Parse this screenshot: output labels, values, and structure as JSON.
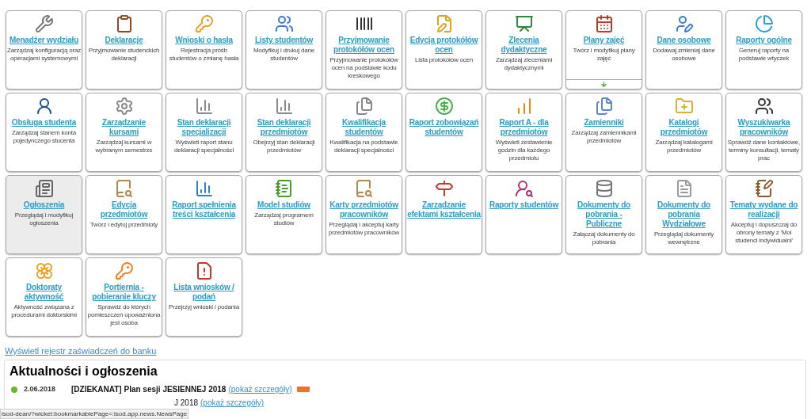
{
  "tiles": [
    {
      "title": "Menadżer wydziału",
      "description": "Zarządzaj konfiguracją oraz operacjami systemowymi",
      "selected": false,
      "kind": "plain"
    },
    {
      "title": "Deklaracje",
      "description": "Przyjmowanie studenckich deklaracji",
      "selected": false,
      "kind": "plain"
    },
    {
      "title": "Wnioski o hasła",
      "description": "Rejestracja próśb studentów o zmianę hasła",
      "selected": false,
      "kind": "plain"
    },
    {
      "title": "Listy studentów",
      "description": "Modyfikuj i drukuj dane studentów",
      "selected": false,
      "kind": "plain"
    },
    {
      "title": "Przyjmowanie protokółów ocen",
      "description": "Przyjmowanie protokółów ocen na podstawie kodu kreskowego",
      "selected": false,
      "kind": "plain"
    },
    {
      "title": "Edycja protokółów ocen",
      "description": "Lista protokółów ocen",
      "selected": false,
      "kind": "plain"
    },
    {
      "title": "Zlecenia dydaktyczne",
      "description": "Zarządzaj zleceniami dydaktycznymi",
      "selected": false,
      "kind": "plain"
    },
    {
      "title": "Plany zajęć",
      "description": "Twórz i modyfikuj plany zajęć",
      "selected": false,
      "kind": "expandable"
    },
    {
      "title": "Dane osobowe",
      "description": "Dodawaj zmieniaj dane osobowe",
      "selected": false,
      "kind": "plain"
    },
    {
      "title": "Raporty ogólne",
      "description": "Generuj raporty na podstawie wtyczek",
      "selected": false,
      "kind": "plain"
    },
    {
      "title": "Obsługa studenta",
      "description": "Zarządzaj stanem konta pojedynczego stucenta",
      "selected": false,
      "kind": "plain"
    },
    {
      "title": "Zarządzanie kursami",
      "description": "Zarządzaj kursami w wybranym semestrze",
      "selected": false,
      "kind": "plain"
    },
    {
      "title": "Stan deklaracji specjalizacji",
      "description": "Wyświetl raport stanu deklaracji specjalności",
      "selected": false,
      "kind": "plain"
    },
    {
      "title": "Stan deklaracji przedmiotów",
      "description": "Obejrzyj stan deklaracji przedmiotów",
      "selected": false,
      "kind": "plain"
    },
    {
      "title": "Kwalifikacja studentów",
      "description": "Kwalifikacja na podstawie deklaracji specjalności",
      "selected": false,
      "kind": "plain"
    },
    {
      "title": "Raport zobowiązań studentów",
      "selected": false,
      "kind": "plain"
    },
    {
      "title": "Raport A - dla przedmiotów",
      "description": "Wyświetl zestawienie godzin dla każdego przedmiotu",
      "selected": false,
      "kind": "plain"
    },
    {
      "title": "Zamienniki",
      "description": "Zarządzaj zamiennikami przedmiotów",
      "selected": false,
      "kind": "plain"
    },
    {
      "title": "Katalogi przedmiotów",
      "description": "Zarządzaj katalogami przedmiotów",
      "selected": false,
      "kind": "plain"
    },
    {
      "title": "Wyszukiwarka pracowników",
      "description": "Sprawdź dane kontaktowe, terminy konsultacji, tematy prac",
      "selected": false,
      "kind": "plain"
    },
    {
      "title": "Ogłoszenia",
      "description": "Przeglądaj i modyfikuj ogłoszenia",
      "selected": true,
      "kind": "plain"
    },
    {
      "title": "Edycja przedmiotów",
      "description": "Twórz i edytuj przedmioty",
      "selected": false,
      "kind": "plain"
    },
    {
      "title": "Raport spełnienia treści kształcenia",
      "selected": false,
      "kind": "plain"
    },
    {
      "title": "Model studiów",
      "description": "Zarządzaj programem studiów",
      "selected": false,
      "kind": "plain"
    },
    {
      "title": "Karty przedmiotów pracowników",
      "description": "Przeglądaj i akceptuj karty przedmiotów pracowników",
      "selected": false,
      "kind": "plain"
    },
    {
      "title": "Zarządzanie efektami kształcenia",
      "selected": false,
      "kind": "plain"
    },
    {
      "title": "Raporty studentów",
      "selected": false,
      "kind": "plain"
    },
    {
      "title": "Dokumenty do pobrania - Publiczne",
      "description": "Załączaj dokumenty do pobrania",
      "selected": false,
      "kind": "plain"
    },
    {
      "title": "Dokumenty do pobrania Wydziałowe",
      "description": "Przeglądaj dokumenty wewnętrzne",
      "selected": false,
      "kind": "plain"
    },
    {
      "title": "Tematy wydane do realizacji",
      "description": "Akceptuj i dopuszczaj do obrony tematy z 'Moi studenci indywidualni'",
      "selected": false,
      "kind": "plain"
    },
    {
      "title": "Doktoraty aktywność",
      "description": "Aktywność związana z procedurami doktorskimi",
      "selected": false,
      "kind": "plain"
    },
    {
      "title": "Portiernia - pobieranie kluczy",
      "description": "Sprawdź do których pomieszczeń upoważniona jest osoba",
      "selected": false,
      "kind": "plain"
    },
    {
      "title": "Lista wniosków / podań",
      "description": "Przejrzyj wnioski / podania",
      "selected": false,
      "kind": "plain"
    }
  ],
  "bank_link": "Wyświetl rejestr zaświadczeń do banku",
  "news": {
    "title": "Aktualności i ogłoszenia",
    "items": [
      {
        "kind": "full",
        "date": "2.06.2018",
        "title": "[DZIEKANAT] Plan sesji JESIENNEJ 2018",
        "link": "(pokaż szczegóły)",
        "is_new": true
      },
      {
        "kind": "cut",
        "title": "J 2018",
        "link": "(pokaż szczegóły)",
        "is_new": false
      }
    ]
  },
  "status_bar": "isod-dean/?wicket:bookmarkablePage=:isod.app.news.NewsPage"
}
